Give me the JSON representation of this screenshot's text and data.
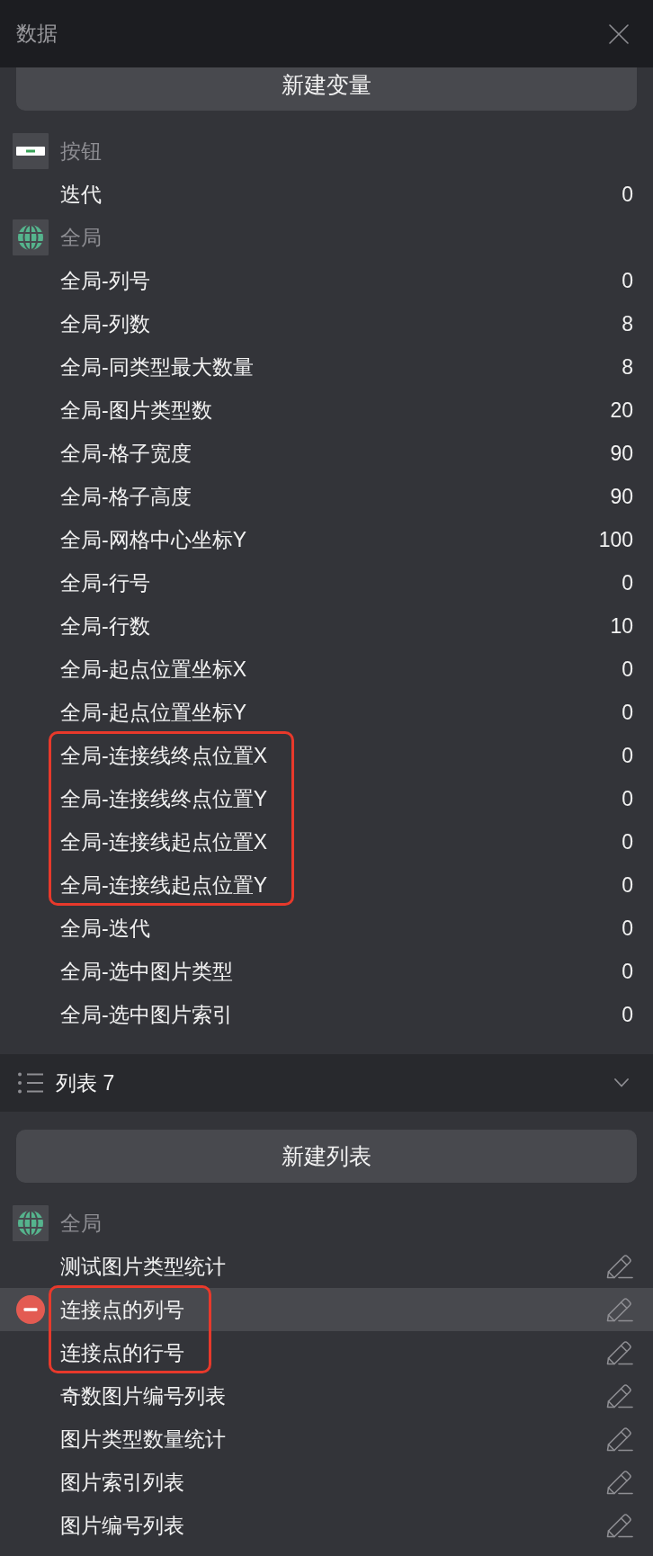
{
  "window": {
    "title": "数据"
  },
  "variables": {
    "new_button": "新建变量",
    "groups": [
      {
        "kind": "widget",
        "label": "按钮",
        "items": [
          {
            "name": "迭代",
            "value": "0",
            "outlined": false
          }
        ]
      },
      {
        "kind": "global",
        "label": "全局",
        "items": [
          {
            "name": "全局-列号",
            "value": "0",
            "outlined": false
          },
          {
            "name": "全局-列数",
            "value": "8",
            "outlined": false
          },
          {
            "name": "全局-同类型最大数量",
            "value": "8",
            "outlined": false
          },
          {
            "name": "全局-图片类型数",
            "value": "20",
            "outlined": false
          },
          {
            "name": "全局-格子宽度",
            "value": "90",
            "outlined": false
          },
          {
            "name": "全局-格子高度",
            "value": "90",
            "outlined": false
          },
          {
            "name": "全局-网格中心坐标Y",
            "value": "100",
            "outlined": false
          },
          {
            "name": "全局-行号",
            "value": "0",
            "outlined": false
          },
          {
            "name": "全局-行数",
            "value": "10",
            "outlined": false
          },
          {
            "name": "全局-起点位置坐标X",
            "value": "0",
            "outlined": false
          },
          {
            "name": "全局-起点位置坐标Y",
            "value": "0",
            "outlined": false
          },
          {
            "name": "全局-连接线终点位置X",
            "value": "0",
            "outlined": true
          },
          {
            "name": "全局-连接线终点位置Y",
            "value": "0",
            "outlined": true
          },
          {
            "name": "全局-连接线起点位置X",
            "value": "0",
            "outlined": true
          },
          {
            "name": "全局-连接线起点位置Y",
            "value": "0",
            "outlined": true
          },
          {
            "name": "全局-迭代",
            "value": "0",
            "outlined": false
          },
          {
            "name": "全局-选中图片类型",
            "value": "0",
            "outlined": false
          },
          {
            "name": "全局-选中图片索引",
            "value": "0",
            "outlined": false
          }
        ]
      }
    ]
  },
  "lists": {
    "header": {
      "title": "列表 7",
      "expanded": true
    },
    "new_button": "新建列表",
    "groups": [
      {
        "kind": "global",
        "label": "全局",
        "items": [
          {
            "name": "测试图片类型统计",
            "selected": false,
            "outlined": false
          },
          {
            "name": "连接点的列号",
            "selected": true,
            "outlined": true
          },
          {
            "name": "连接点的行号",
            "selected": false,
            "outlined": true
          },
          {
            "name": "奇数图片编号列表",
            "selected": false,
            "outlined": false
          },
          {
            "name": "图片类型数量统计",
            "selected": false,
            "outlined": false
          },
          {
            "name": "图片索引列表",
            "selected": false,
            "outlined": false
          },
          {
            "name": "图片编号列表",
            "selected": false,
            "outlined": false
          }
        ]
      }
    ]
  }
}
